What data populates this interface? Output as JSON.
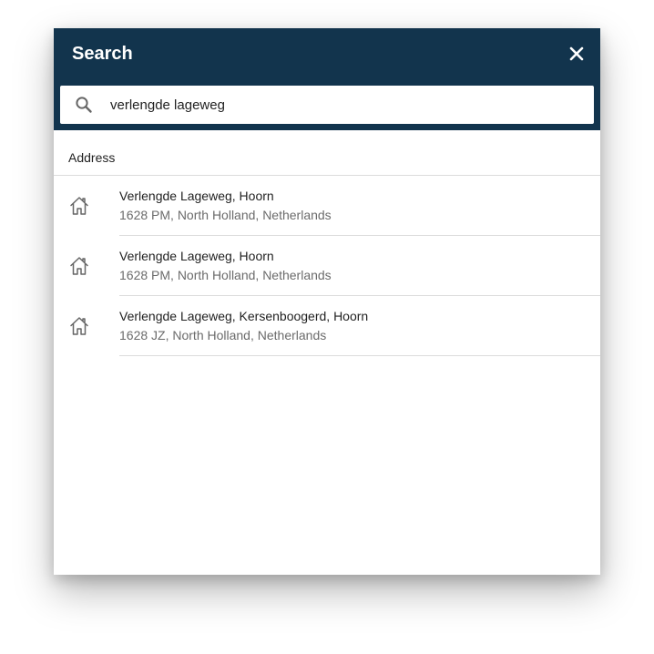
{
  "dialog": {
    "title": "Search",
    "close_icon": "close-icon"
  },
  "search": {
    "icon": "search-icon",
    "value": "verlengde lageweg"
  },
  "section": {
    "label": "Address"
  },
  "results": [
    {
      "icon": "home-icon",
      "title": "Verlengde Lageweg, Hoorn",
      "subtitle": "1628 PM, North Holland, Netherlands"
    },
    {
      "icon": "home-icon",
      "title": "Verlengde Lageweg, Hoorn",
      "subtitle": "1628 PM, North Holland, Netherlands"
    },
    {
      "icon": "home-icon",
      "title": "Verlengde Lageweg, Kersenboogerd, Hoorn",
      "subtitle": "1628 JZ, North Holland, Netherlands"
    }
  ],
  "colors": {
    "header_bg": "#12344d",
    "header_text": "#ffffff",
    "primary_text": "#222222",
    "secondary_text": "#6b6b6b",
    "divider": "#dcdcdc"
  }
}
